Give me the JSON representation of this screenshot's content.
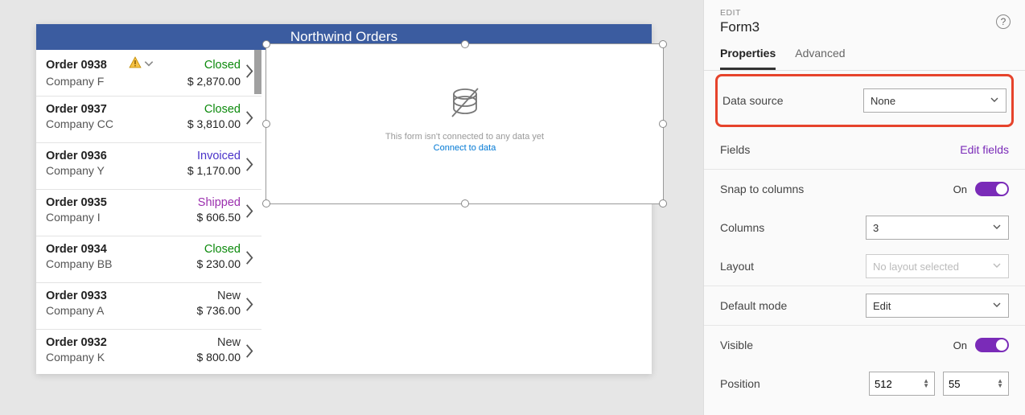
{
  "canvas": {
    "title": "Northwind Orders",
    "form_placeholder_msg": "This form isn't connected to any data yet",
    "form_placeholder_link": "Connect to data"
  },
  "orders": [
    {
      "id": "Order 0938",
      "company": "Company F",
      "status": "Closed",
      "amount": "$ 2,870.00",
      "has_warning": true,
      "has_caret": true
    },
    {
      "id": "Order 0937",
      "company": "Company CC",
      "status": "Closed",
      "amount": "$ 3,810.00",
      "has_warning": false,
      "has_caret": false
    },
    {
      "id": "Order 0936",
      "company": "Company Y",
      "status": "Invoiced",
      "amount": "$ 1,170.00",
      "has_warning": false,
      "has_caret": false
    },
    {
      "id": "Order 0935",
      "company": "Company I",
      "status": "Shipped",
      "amount": "$ 606.50",
      "has_warning": false,
      "has_caret": false
    },
    {
      "id": "Order 0934",
      "company": "Company BB",
      "status": "Closed",
      "amount": "$ 230.00",
      "has_warning": false,
      "has_caret": false
    },
    {
      "id": "Order 0933",
      "company": "Company A",
      "status": "New",
      "amount": "$ 736.00",
      "has_warning": false,
      "has_caret": false
    },
    {
      "id": "Order 0932",
      "company": "Company K",
      "status": "New",
      "amount": "$ 800.00",
      "has_warning": false,
      "has_caret": false
    }
  ],
  "panel": {
    "edit_label": "EDIT",
    "form_name": "Form3",
    "tabs": {
      "properties": "Properties",
      "advanced": "Advanced"
    },
    "data_source": {
      "label": "Data source",
      "value": "None"
    },
    "fields": {
      "label": "Fields",
      "edit": "Edit fields"
    },
    "snap": {
      "label": "Snap to columns",
      "state": "On"
    },
    "columns": {
      "label": "Columns",
      "value": "3"
    },
    "layout": {
      "label": "Layout",
      "value": "No layout selected"
    },
    "default_mode": {
      "label": "Default mode",
      "value": "Edit"
    },
    "visible": {
      "label": "Visible",
      "state": "On"
    },
    "position": {
      "label": "Position",
      "x": "512",
      "y": "55"
    }
  }
}
